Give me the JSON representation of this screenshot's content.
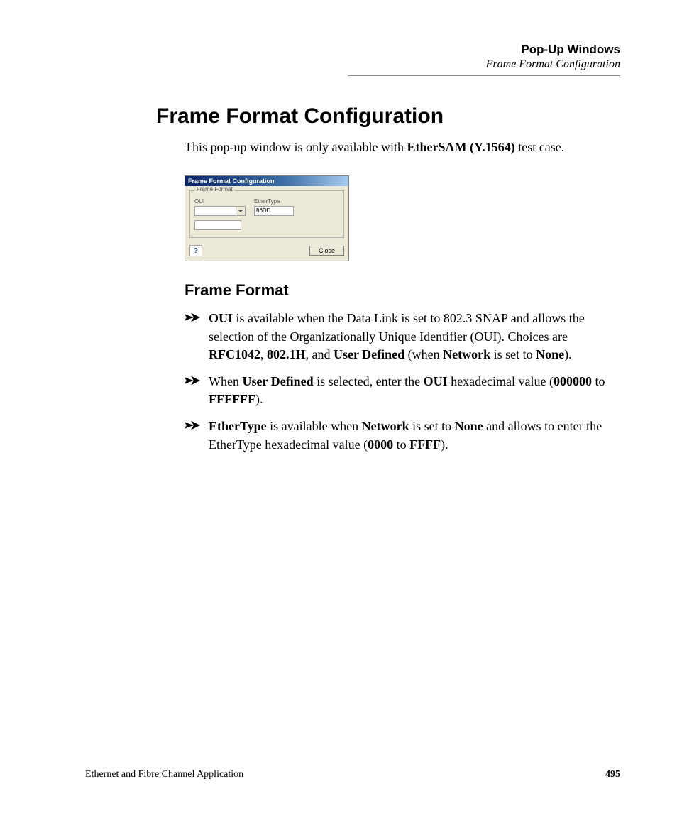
{
  "header": {
    "chapter": "Pop-Up Windows",
    "section": "Frame Format Configuration"
  },
  "title": "Frame Format Configuration",
  "intro": {
    "prefix": "This pop-up window is only available with ",
    "bold": "EtherSAM (Y.1564)",
    "suffix": " test case."
  },
  "dialog": {
    "title": "Frame Format Configuration",
    "group_label": "Frame Format",
    "oui_label": "OUI",
    "ethertype_label": "EtherType",
    "ethertype_value": "86DD",
    "close_label": "Close",
    "help_symbol": "?"
  },
  "subhead": "Frame Format",
  "bullets": [
    {
      "segments": [
        {
          "b": true,
          "t": "OUI"
        },
        {
          "b": false,
          "t": " is available when the Data Link is set to 802.3 SNAP and allows the selection of the Organizationally Unique Identifier (OUI). Choices are "
        },
        {
          "b": true,
          "t": "RFC1042"
        },
        {
          "b": false,
          "t": ", "
        },
        {
          "b": true,
          "t": "802.1H"
        },
        {
          "b": false,
          "t": ", and "
        },
        {
          "b": true,
          "t": "User Defined"
        },
        {
          "b": false,
          "t": " (when "
        },
        {
          "b": true,
          "t": "Network"
        },
        {
          "b": false,
          "t": " is set to "
        },
        {
          "b": true,
          "t": "None"
        },
        {
          "b": false,
          "t": ")."
        }
      ]
    },
    {
      "segments": [
        {
          "b": false,
          "t": "When "
        },
        {
          "b": true,
          "t": "User Defined"
        },
        {
          "b": false,
          "t": " is selected, enter the "
        },
        {
          "b": true,
          "t": "OUI"
        },
        {
          "b": false,
          "t": " hexadecimal value ("
        },
        {
          "b": true,
          "t": "000000"
        },
        {
          "b": false,
          "t": " to "
        },
        {
          "b": true,
          "t": "FFFFFF"
        },
        {
          "b": false,
          "t": ")."
        }
      ]
    },
    {
      "segments": [
        {
          "b": true,
          "t": "EtherType"
        },
        {
          "b": false,
          "t": " is available when "
        },
        {
          "b": true,
          "t": "Network"
        },
        {
          "b": false,
          "t": " is set to "
        },
        {
          "b": true,
          "t": "None"
        },
        {
          "b": false,
          "t": " and allows to enter the EtherType hexadecimal value ("
        },
        {
          "b": true,
          "t": "0000"
        },
        {
          "b": false,
          "t": " to "
        },
        {
          "b": true,
          "t": "FFFF"
        },
        {
          "b": false,
          "t": ")."
        }
      ]
    }
  ],
  "footer": {
    "doc_title": "Ethernet and Fibre Channel Application",
    "page_number": "495"
  }
}
